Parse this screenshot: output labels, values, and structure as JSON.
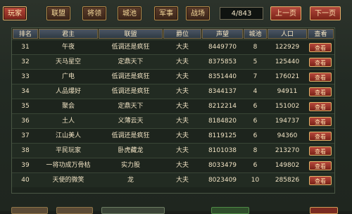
{
  "tabs": [
    {
      "label": "玩家",
      "active": true
    },
    {
      "label": "联盟",
      "active": false
    },
    {
      "label": "将领",
      "active": false
    },
    {
      "label": "城池",
      "active": false
    },
    {
      "label": "军事",
      "active": false
    },
    {
      "label": "战场",
      "active": false
    }
  ],
  "pagination": {
    "page_label": "4/843",
    "prev_label": "上一页",
    "next_label": "下一页"
  },
  "table": {
    "headers": [
      "排名",
      "君主",
      "联盟",
      "爵位",
      "声望",
      "城池",
      "人口",
      "查看"
    ],
    "rows": [
      {
        "rank": "31",
        "lord": "午夜",
        "alliance": "低调还是疯狂",
        "title": "大夫",
        "prestige": "8449770",
        "cities": "8",
        "population": "122929",
        "action": "查看"
      },
      {
        "rank": "32",
        "lord": "天马星空",
        "alliance": "定鼎天下",
        "title": "大夫",
        "prestige": "8375853",
        "cities": "5",
        "population": "125440",
        "action": "查看"
      },
      {
        "rank": "33",
        "lord": "广电",
        "alliance": "低调还是疯狂",
        "title": "大夫",
        "prestige": "8351440",
        "cities": "7",
        "population": "176021",
        "action": "查看"
      },
      {
        "rank": "34",
        "lord": "人品爆好",
        "alliance": "低调还是疯狂",
        "title": "大夫",
        "prestige": "8344137",
        "cities": "4",
        "population": "94911",
        "action": "查看"
      },
      {
        "rank": "35",
        "lord": "聚会",
        "alliance": "定鼎天下",
        "title": "大夫",
        "prestige": "8212214",
        "cities": "6",
        "population": "151002",
        "action": "查看"
      },
      {
        "rank": "36",
        "lord": "土人",
        "alliance": "义薄云天",
        "title": "大夫",
        "prestige": "8184820",
        "cities": "6",
        "population": "194737",
        "action": "查看"
      },
      {
        "rank": "37",
        "lord": "江山美人",
        "alliance": "低调还是疯狂",
        "title": "大夫",
        "prestige": "8119125",
        "cities": "6",
        "population": "94360",
        "action": "查看"
      },
      {
        "rank": "38",
        "lord": "平民玩家",
        "alliance": "卧虎藏龙",
        "title": "大夫",
        "prestige": "8101038",
        "cities": "8",
        "population": "213270",
        "action": "查看"
      },
      {
        "rank": "39",
        "lord": "一将功成万骨枯",
        "alliance": "实力股",
        "title": "大夫",
        "prestige": "8033479",
        "cities": "6",
        "population": "149802",
        "action": "查看"
      },
      {
        "rank": "40",
        "lord": "天使的微笑",
        "alliance": "龙",
        "title": "大夫",
        "prestige": "8023409",
        "cities": "10",
        "population": "285826",
        "action": "查看"
      }
    ]
  },
  "colors": {
    "accent_red": "#b2483c",
    "gold_border": "#e2b06a",
    "panel_bg": "#1d241d"
  }
}
